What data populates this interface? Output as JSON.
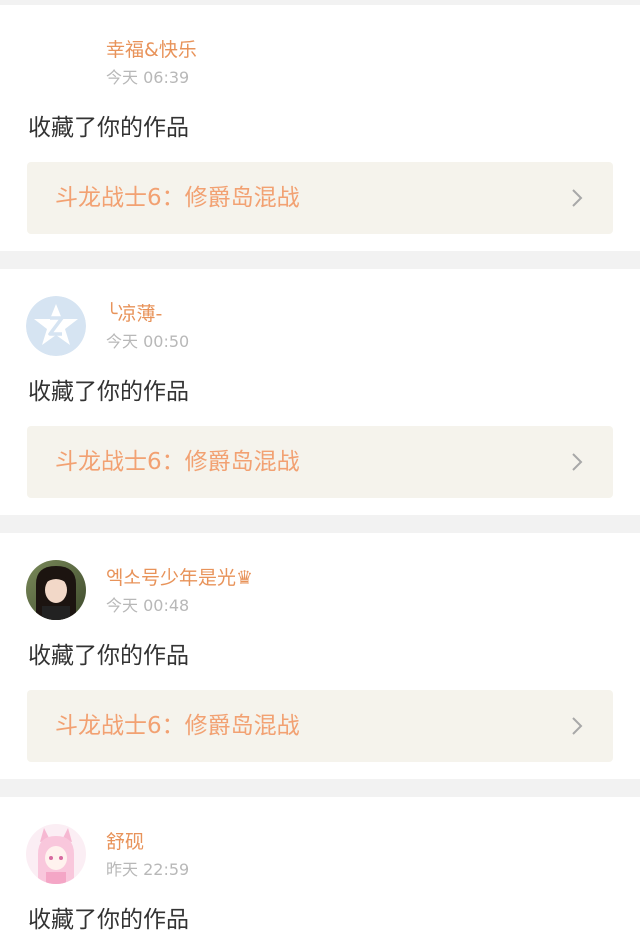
{
  "notifications": [
    {
      "username": "幸福&快乐",
      "timestamp": "今天 06:39",
      "action": "收藏了你的作品",
      "work_title": "斗龙战士6：修爵岛混战",
      "avatar": "blank-avatar"
    },
    {
      "username": "╰凉薄-",
      "timestamp": "今天 00:50",
      "action": "收藏了你的作品",
      "work_title": "斗龙战士6：修爵岛混战",
      "avatar": "qzone-default-avatar"
    },
    {
      "username": "엑소号少年是光♛",
      "timestamp": "今天 00:48",
      "action": "收藏了你的作品",
      "work_title": "斗龙战士6：修爵岛混战",
      "avatar": "girl-photo-avatar"
    },
    {
      "username": "舒砚",
      "timestamp": "昨天 22:59",
      "action": "收藏了你的作品",
      "avatar": "anime-girl-avatar"
    }
  ],
  "icons": {
    "chevron": "chevron-right-icon"
  },
  "colors": {
    "username": "#e8935a",
    "work_title": "#f2a172",
    "link_background": "#f5f3ec",
    "separator": "#f2f2f2"
  }
}
